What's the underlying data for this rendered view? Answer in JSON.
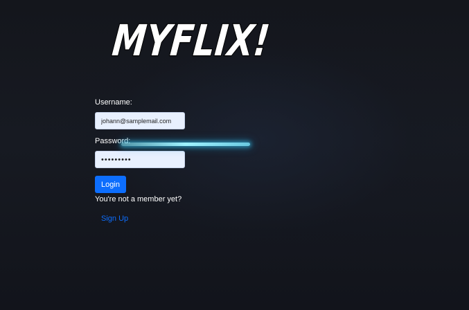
{
  "app": {
    "logo_text": "MYFLIX!"
  },
  "login_form": {
    "username_label": "Username:",
    "username_value": "johann@samplemail.com",
    "password_label": "Password:",
    "password_value": "•••••••••",
    "login_button_label": "Login",
    "member_prompt": "You're not a member yet?",
    "signup_link_label": "Sign Up"
  },
  "colors": {
    "background": "#15171e",
    "primary_button": "#0d6efd",
    "link": "#0d6efd",
    "input_background": "#e8f0fe",
    "label_text": "#ffffff"
  }
}
